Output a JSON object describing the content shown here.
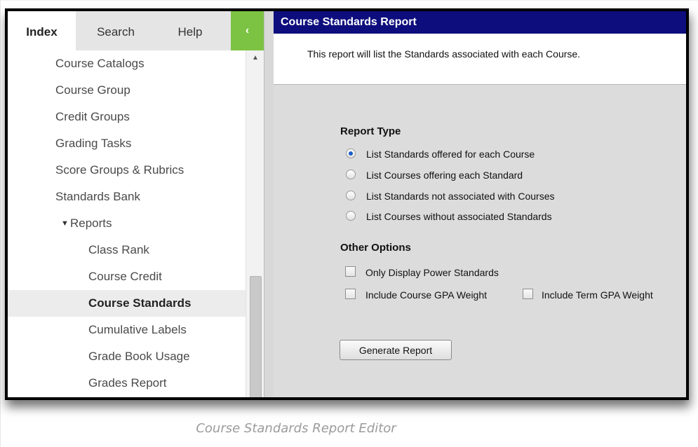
{
  "tabs": {
    "index": "Index",
    "search": "Search",
    "help": "Help",
    "collapse_glyph": "‹"
  },
  "nav": {
    "items": [
      {
        "label": "Course Catalogs"
      },
      {
        "label": "Course Group"
      },
      {
        "label": "Credit Groups"
      },
      {
        "label": "Grading Tasks"
      },
      {
        "label": "Score Groups & Rubrics"
      },
      {
        "label": "Standards Bank"
      },
      {
        "label": "Reports",
        "expanded": true
      },
      {
        "label": "Class Rank"
      },
      {
        "label": "Course Credit"
      },
      {
        "label": "Course Standards",
        "selected": true
      },
      {
        "label": "Cumulative Labels"
      },
      {
        "label": "Grade Book Usage"
      },
      {
        "label": "Grades Report"
      }
    ],
    "expand_arrow": "▼",
    "scroll_up_glyph": "▲"
  },
  "report": {
    "title": "Course Standards Report",
    "description": "This report will list the Standards associated with each Course.",
    "report_type_label": "Report Type",
    "report_types": [
      {
        "label": "List Standards offered for each Course",
        "checked": true
      },
      {
        "label": "List Courses offering each Standard",
        "checked": false
      },
      {
        "label": "List Standards not associated with Courses",
        "checked": false
      },
      {
        "label": "List Courses without associated Standards",
        "checked": false
      }
    ],
    "other_options_label": "Other Options",
    "options": {
      "power_standards": {
        "label": "Only Display Power Standards",
        "checked": false
      },
      "course_gpa": {
        "label": "Include Course GPA Weight",
        "checked": false
      },
      "term_gpa": {
        "label": "Include Term GPA Weight",
        "checked": false
      }
    },
    "generate_label": "Generate Report"
  },
  "caption": "Course Standards Report Editor",
  "colors": {
    "header_bg": "#0d0d7d",
    "collapse_bg": "#7cc243",
    "panel_bg": "#dcdcdc"
  }
}
